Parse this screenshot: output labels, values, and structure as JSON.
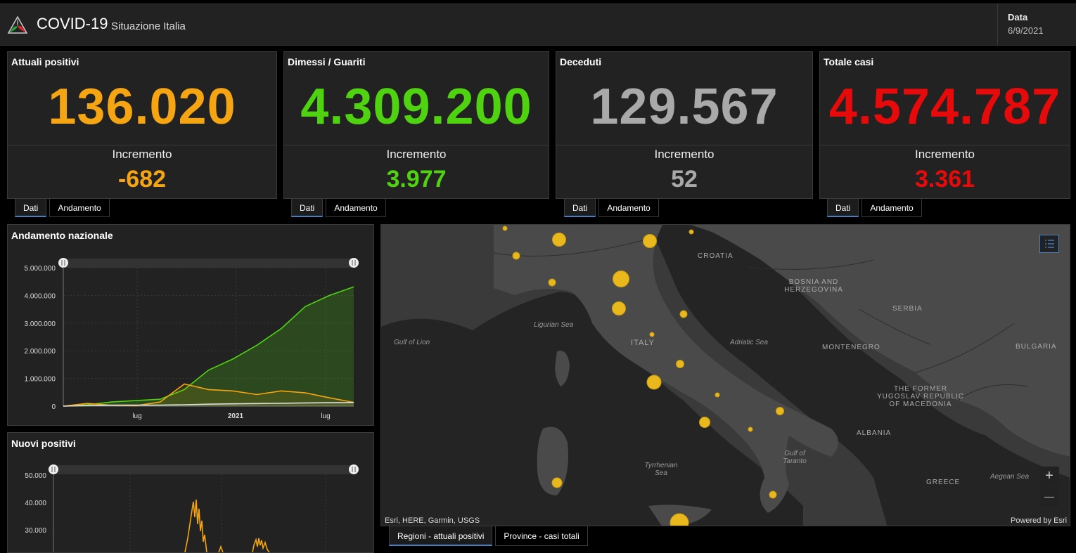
{
  "header": {
    "title": "COVID-19",
    "subtitle": "Situazione Italia",
    "date_label": "Data",
    "date_value": "6/9/2021"
  },
  "colors": {
    "positivi": "#f5a511",
    "guariti": "#4fd311",
    "deceduti": "#a9a9a9",
    "totale": "#e60a0a",
    "tab_active": "#4a7fbf",
    "map_dot": "#e8b81c"
  },
  "cards": [
    {
      "title": "Attuali positivi",
      "value": "136.020",
      "inc_label": "Incremento",
      "inc_value": "-682"
    },
    {
      "title": "Dimessi / Guariti",
      "value": "4.309.200",
      "inc_label": "Incremento",
      "inc_value": "3.977"
    },
    {
      "title": "Deceduti",
      "value": "129.567",
      "inc_label": "Incremento",
      "inc_value": "52"
    },
    {
      "title": "Totale casi",
      "value": "4.574.787",
      "inc_label": "Incremento",
      "inc_value": "3.361"
    }
  ],
  "card_tabs": {
    "dati": "Dati",
    "andamento": "Andamento"
  },
  "chart_data": [
    {
      "type": "area",
      "title": "Andamento nazionale",
      "y_ticks": [
        "0",
        "1.000.000",
        "2.000.000",
        "3.000.000",
        "4.000.000",
        "5.000.000"
      ],
      "x_ticks": [
        "lug",
        "2021",
        "lug"
      ],
      "ylim": [
        0,
        5000000
      ],
      "x": [
        "2020-02",
        "2020-04",
        "2020-06",
        "2020-08",
        "2020-10",
        "2020-11",
        "2020-12",
        "2021-01",
        "2021-02",
        "2021-03",
        "2021-04",
        "2021-05",
        "2021-06"
      ],
      "series": [
        {
          "values": [
            0,
            50000,
            150000,
            200000,
            250000,
            600000,
            1300000,
            1700000,
            2200000,
            2800000,
            3600000,
            4000000,
            4309200
          ]
        },
        {
          "values": [
            0,
            100000,
            30000,
            15000,
            150000,
            800000,
            600000,
            550000,
            420000,
            550000,
            480000,
            300000,
            136020
          ]
        },
        {
          "values": [
            0,
            20000,
            35000,
            36000,
            38000,
            50000,
            70000,
            85000,
            95000,
            105000,
            118000,
            125000,
            129567
          ]
        }
      ]
    },
    {
      "type": "line",
      "title": "Nuovi positivi",
      "y_ticks": [
        "30.000",
        "40.000",
        "50.000"
      ],
      "ylim": [
        0,
        50000
      ]
    }
  ],
  "map": {
    "labels": [
      "CROATIA",
      "BOSNIA AND HERZEGOVINA",
      "SERBIA",
      "Ligurian Sea",
      "Gulf of Lion",
      "ITALY",
      "Adriatic Sea",
      "MONTENEGRO",
      "BULGARIA",
      "THE FORMER YUGOSLAV REPUBLIC OF MACEDONIA",
      "ALBANIA",
      "Gulf of Taranto",
      "Tyrrhenian Sea",
      "GREECE",
      "Aegean Sea"
    ],
    "attribution": "Esri, HERE, Garmin, USGS",
    "powered_by": "Powered by Esri",
    "zoom_in": "+",
    "zoom_out": "—"
  },
  "map_tabs": {
    "regioni": "Regioni - attuali positivi",
    "province": "Province - casi totali"
  }
}
